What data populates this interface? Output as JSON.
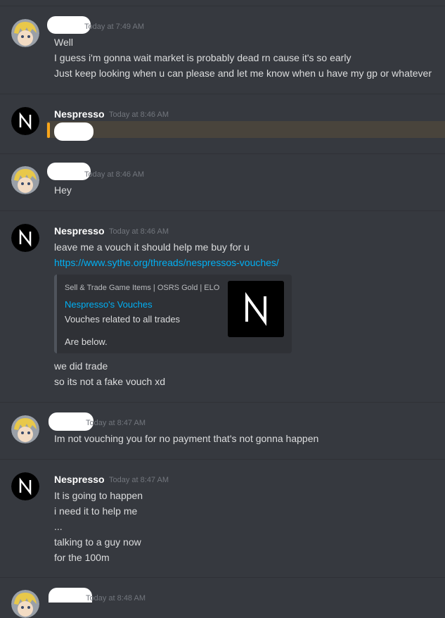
{
  "messages": [
    {
      "timestamp": "Today at 7:49 AM",
      "lines": [
        "Well",
        "I guess i'm gonna wait market is probably dead rn cause it's so early",
        "Just keep looking when u can please and let me know when u have my gp or whatever"
      ]
    },
    {
      "author": "Nespresso",
      "timestamp": "Today at 8:46 AM"
    },
    {
      "timestamp": "Today at 8:46 AM",
      "lines": [
        "Hey"
      ]
    },
    {
      "author": "Nespresso",
      "timestamp": "Today at 8:46 AM",
      "lines": [
        "leave me a vouch it should help me buy for u",
        "https://www.sythe.org/threads/nespressos-vouches/"
      ],
      "embed": {
        "provider": "Sell & Trade Game Items | OSRS Gold | ELO",
        "title": "Nespresso's Vouches",
        "description": "Vouches related to all trades",
        "description2": "Are below."
      },
      "after_lines": [
        "we did trade",
        "so its not a fake vouch xd"
      ]
    },
    {
      "timestamp": "Today at 8:47 AM",
      "lines": [
        "Im not vouching you for no payment that's not gonna happen"
      ]
    },
    {
      "author": "Nespresso",
      "timestamp": "Today at 8:47 AM",
      "lines": [
        "It is going to happen",
        "i need it to help me",
        "...",
        "talking to a guy now",
        "for the 100m"
      ]
    },
    {
      "timestamp": "Today at 8:48 AM"
    }
  ],
  "colors": {
    "background": "#36393f",
    "username": "#ffffff",
    "text": "#dcddde",
    "timestamp": "#72767d",
    "link": "#00b0f4",
    "mention_highlight": "#faa61a"
  }
}
